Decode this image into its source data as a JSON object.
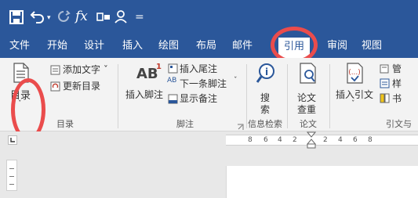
{
  "quick_access": {
    "save_icon": "save-icon",
    "undo_icon": "undo-icon",
    "redo_icon": "redo-icon",
    "formula_glyph": "fx",
    "customize_glyph": "="
  },
  "tabs": [
    {
      "label": "文件"
    },
    {
      "label": "开始"
    },
    {
      "label": "设计"
    },
    {
      "label": "插入"
    },
    {
      "label": "绘图"
    },
    {
      "label": "布局"
    },
    {
      "label": "邮件"
    },
    {
      "label": "引用",
      "active": true
    },
    {
      "label": "审阅"
    },
    {
      "label": "视图"
    }
  ],
  "ribbon": {
    "toc": {
      "main_label": "目录",
      "add_text": "添加文字 ˇ",
      "update_toc": "更新目录",
      "group_label": "目录"
    },
    "footnotes": {
      "insert_footnote": "插入脚注",
      "insert_endnote": "插入尾注",
      "next_footnote": "下一条脚注",
      "show_notes": "显示备注",
      "group_label": "脚注",
      "ab_glyph": "AB",
      "ab_superscript": "1"
    },
    "search": {
      "label_line1": "搜",
      "label_line2": "索",
      "group_label": "信息检索"
    },
    "paper": {
      "label_line1": "论文",
      "label_line2": "查重",
      "group_label": "论文"
    },
    "citations": {
      "insert_citation": "插入引文",
      "manage": "管",
      "style": "样",
      "bibliography": "书",
      "group_label": "引文与"
    }
  },
  "ruler": {
    "numbers": [
      "8",
      "6",
      "4",
      "2",
      "2",
      "4",
      "6",
      "8"
    ]
  },
  "colors": {
    "accent": "#2b579a",
    "highlight": "#ea4c4c",
    "ribbon_bg": "#f3f3f3"
  }
}
